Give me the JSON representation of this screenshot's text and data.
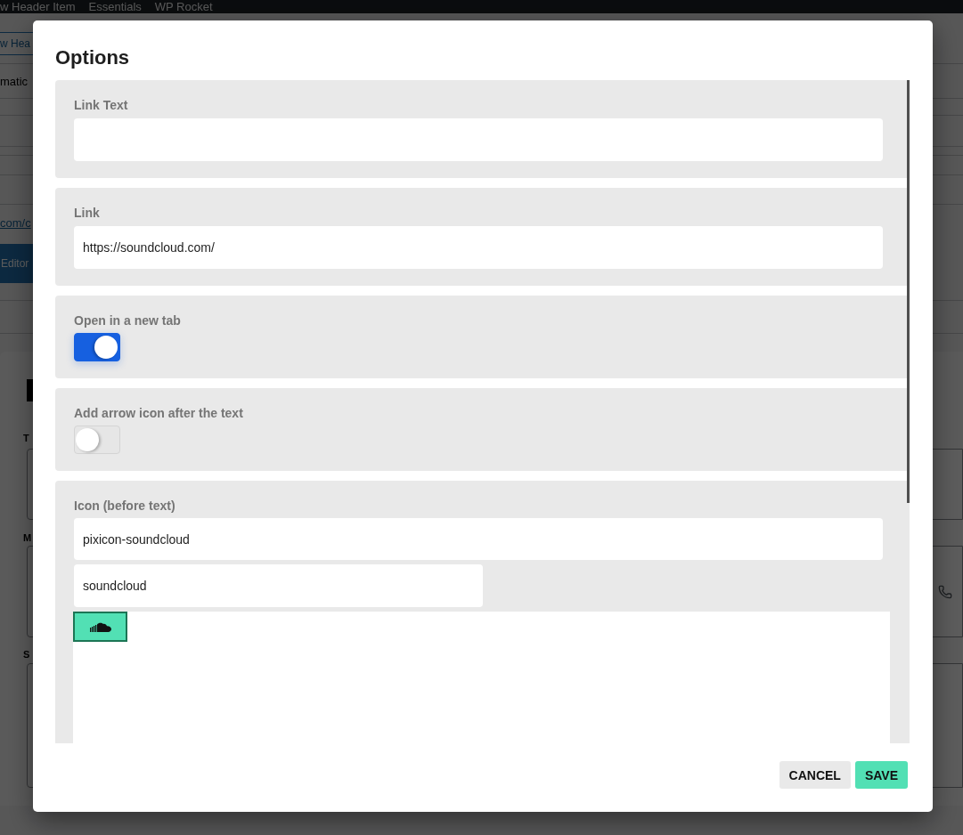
{
  "background_page": {
    "admin_bar": [
      "w Header Item",
      "Essentials",
      "WP Rocket"
    ],
    "header_button": "w Hea",
    "setting_text": "matic",
    "url_link": "com/c",
    "editor_button": "Editor",
    "form_labels": [
      "T",
      "M",
      "S"
    ]
  },
  "modal": {
    "title": "Options",
    "fields": [
      {
        "kind": "text",
        "label": "Link Text"
      },
      {
        "kind": "text",
        "label": "Link",
        "value": "https://soundcloud.com/"
      },
      {
        "kind": "toggle",
        "label": "Open in a new tab",
        "on": true
      },
      {
        "kind": "toggle",
        "label": "Add arrow icon after the text",
        "on": false
      },
      {
        "kind": "icon_picker",
        "label": "Icon (before text)",
        "value": "pixicon-soundcloud",
        "search": "soundcloud",
        "icons": [
          {
            "selected": true
          }
        ]
      }
    ],
    "buttons": [
      {
        "label": "CANCEL",
        "kind": "secondary"
      },
      {
        "label": "SAVE",
        "kind": "primary"
      }
    ]
  }
}
